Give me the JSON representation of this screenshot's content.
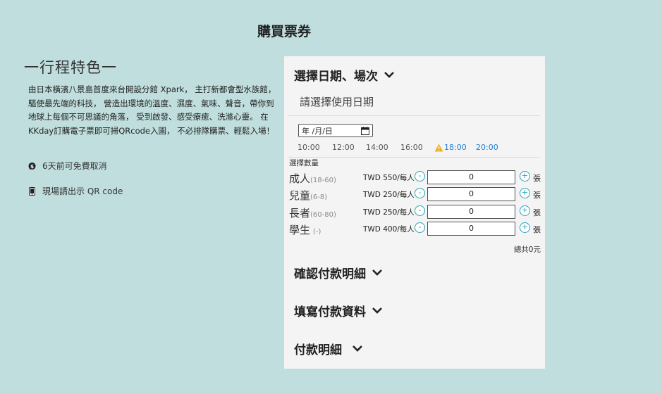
{
  "page_title": "購買票券",
  "features": {
    "heading": "一行程特色一",
    "description": "由日本橫濱八景島首度來台開設分館 Xpark， 主打新都會型水族館，驅使最先端的科技， 營造出環境的溫度、濕度、氣味、聲音，帶你到地球上每個不可思議的角落， 受到啟發、感受療癒、洗滌心靈。 在KKday訂購電子票即可掃QRcode入園， 不必排隊購票、輕鬆入場！",
    "cancel_policy": "6天前可免費取消",
    "voucher_note": "現場請出示 QR code"
  },
  "booking": {
    "date_section_title": "選擇日期、場次",
    "date_prompt": "請選擇使用日期",
    "date_input_placeholder": "年 /月/日",
    "time_slots": [
      {
        "time": "10:00",
        "state": "normal"
      },
      {
        "time": "12:00",
        "state": "normal"
      },
      {
        "time": "14:00",
        "state": "normal"
      },
      {
        "time": "16:00",
        "state": "normal"
      },
      {
        "time": "18:00",
        "state": "warning"
      },
      {
        "time": "20:00",
        "state": "available"
      }
    ],
    "quantity_label": "選擇數量",
    "tickets": [
      {
        "name": "成人",
        "age": "(18-60)",
        "price": "TWD 550/每人",
        "qty": "0",
        "unit": "張"
      },
      {
        "name": "兒童",
        "age": "(6-8)",
        "price": "TWD 250/每人",
        "qty": "0",
        "unit": "張"
      },
      {
        "name": "長者",
        "age": "(60-80)",
        "price": "TWD 250/每人",
        "qty": "0",
        "unit": "張"
      },
      {
        "name": "學生",
        "age": "(-)",
        "price": "TWD 400/每人",
        "qty": "0",
        "unit": "張"
      }
    ],
    "total": "總共0元",
    "confirm_section_title": "確認付款明細",
    "payment_info_section_title": "填寫付款資料",
    "payment_detail_section_title": "付款明細"
  },
  "colors": {
    "background": "#bfdedd",
    "panel": "#f4f4f4",
    "accent": "#2aa3ba",
    "link": "#1e7fd6",
    "warning": "#f0b21a"
  }
}
